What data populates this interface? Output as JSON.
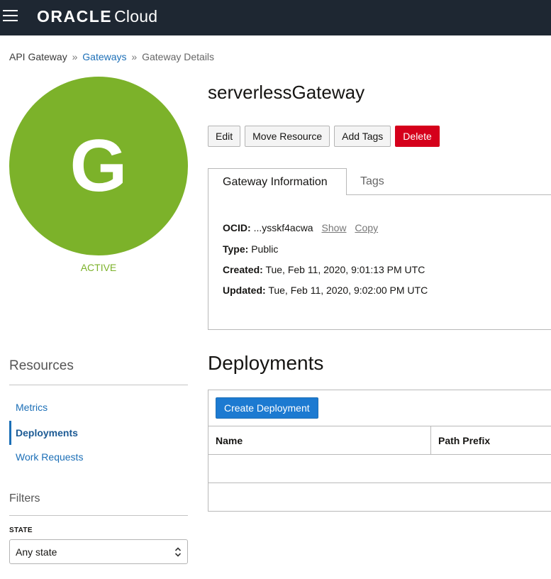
{
  "header": {
    "brand": "ORACLE",
    "product": "Cloud"
  },
  "breadcrumb": {
    "root": "API Gateway",
    "parent": "Gateways",
    "current": "Gateway Details",
    "separator": "»"
  },
  "gateway": {
    "avatar_letter": "G",
    "state": "ACTIVE",
    "name": "serverlessGateway"
  },
  "actions": {
    "edit": "Edit",
    "move_resource": "Move Resource",
    "add_tags": "Add Tags",
    "delete": "Delete"
  },
  "tabs": {
    "gateway_information": "Gateway Information",
    "tags": "Tags"
  },
  "info": {
    "ocid_label": "OCID:",
    "ocid_value": "...ysskf4acwa",
    "ocid_show": "Show",
    "ocid_copy": "Copy",
    "type_label": "Type:",
    "type_value": "Public",
    "created_label": "Created:",
    "created_value": "Tue, Feb 11, 2020, 9:01:13 PM UTC",
    "updated_label": "Updated:",
    "updated_value": "Tue, Feb 11, 2020, 9:02:00 PM UTC"
  },
  "resources": {
    "title": "Resources",
    "items": [
      "Metrics",
      "Deployments",
      "Work Requests"
    ],
    "active": "Deployments"
  },
  "filters": {
    "title": "Filters",
    "state_label": "STATE",
    "state_value": "Any state"
  },
  "deployments": {
    "title": "Deployments",
    "create_button": "Create Deployment",
    "columns": [
      "Name",
      "Path Prefix"
    ]
  },
  "colors": {
    "topbar": "#1e2732",
    "avatar": "#7cb22a",
    "link": "#1c6fb7",
    "danger": "#d5001b",
    "primary": "#1c7ad1"
  }
}
